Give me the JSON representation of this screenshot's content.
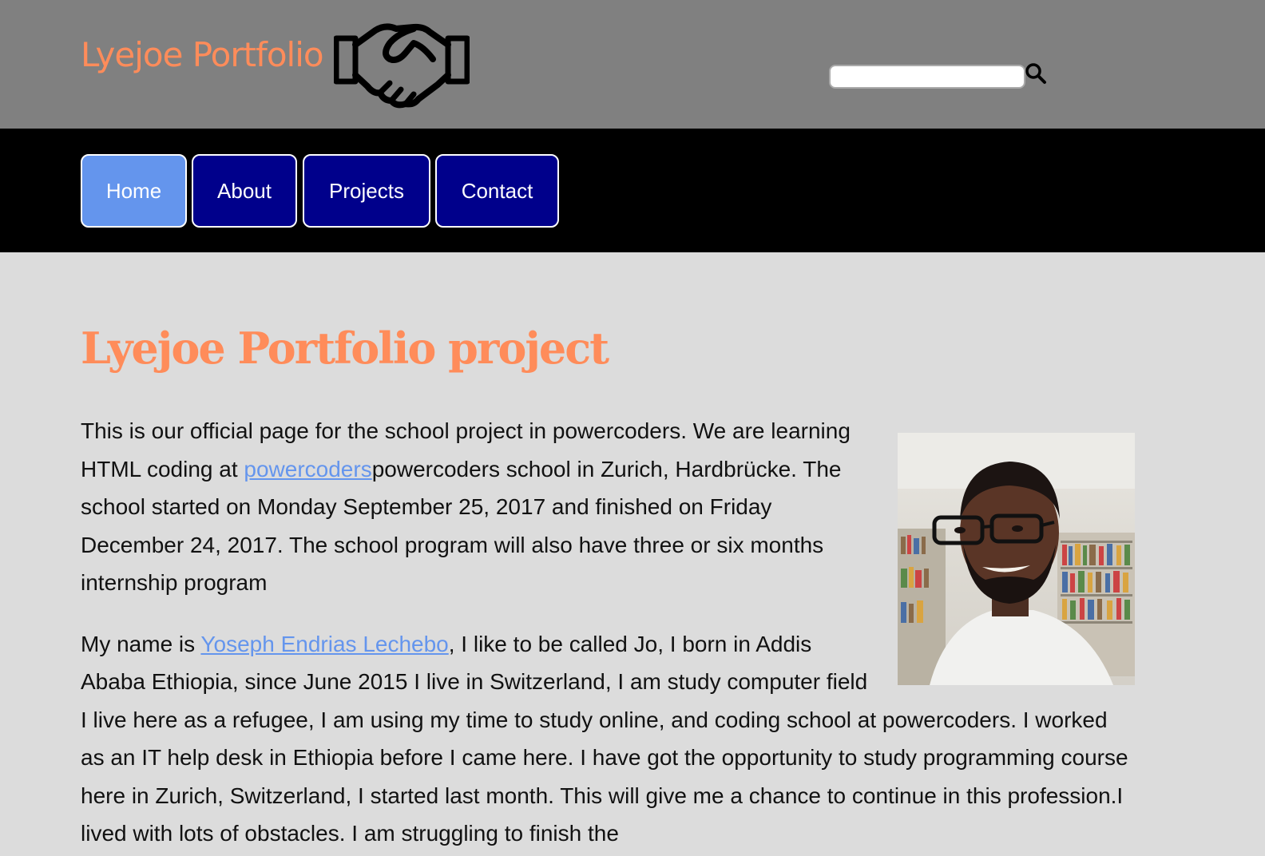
{
  "header": {
    "site_title": "Lyejoe Portfolio",
    "logo_icon": "handshake-icon",
    "search": {
      "placeholder": "",
      "value": "",
      "icon": "search-icon"
    }
  },
  "nav": {
    "items": [
      {
        "label": "Home",
        "active": true
      },
      {
        "label": "About",
        "active": false
      },
      {
        "label": "Projects",
        "active": false
      },
      {
        "label": "Contact",
        "active": false
      }
    ]
  },
  "main": {
    "title": "Lyejoe Portfolio project",
    "paragraph1": {
      "part1": "This is our official page for the school project in powercoders. We are learning HTML coding at ",
      "link": "powercoders",
      "part2": "powercoders school in Zurich, Hardbrücke. The school started on Monday September 25, 2017 and finished on Friday December 24, 2017. The school program will also have three or six months internship program"
    },
    "paragraph2": {
      "part1": "My name is ",
      "link": "Yoseph Endrias Lechebo",
      "part2": ", I like to be called Jo, I born in Addis Ababa Ethiopia, since June 2015 I live in Switzerland, I am study computer field I live here as a refugee, I am using my time to study online, and coding school at powercoders. I worked as an IT help desk in Ethiopia before I came here. I have got the opportunity to study programming course here in Zurich, Switzerland, I started last month. This will give me a chance to continue in this profession.I lived with lots of obstacles. I am struggling to finish the"
    }
  },
  "colors": {
    "header_bg": "#808080",
    "nav_bg": "#000000",
    "nav_button": "#00008b",
    "nav_active": "#6495ed",
    "accent": "#ff8c5a",
    "link": "#6495ed",
    "page_bg": "#dcdcdc"
  }
}
